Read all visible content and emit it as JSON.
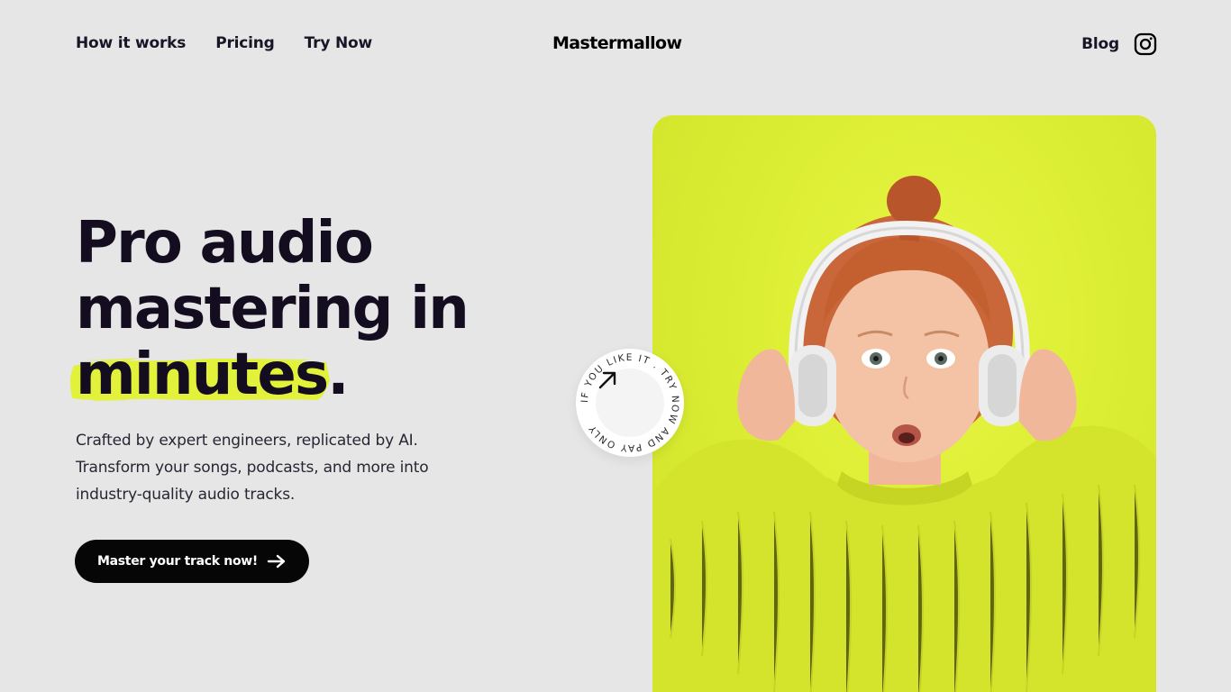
{
  "nav": {
    "links": [
      {
        "label": "How it works"
      },
      {
        "label": "Pricing"
      },
      {
        "label": "Try Now"
      }
    ],
    "brand": "Mastermallow",
    "blog": "Blog",
    "social_icon": "instagram-icon"
  },
  "hero": {
    "headline_line1": "Pro audio",
    "headline_line2": "mastering in",
    "headline_highlight": "minutes",
    "headline_period": ".",
    "subtext": [
      "Crafted by expert engineers, replicated by AI.",
      "Transform your songs, podcasts, and more into",
      "industry-quality audio tracks."
    ],
    "cta_label": "Master your track now!",
    "cta_icon": "arrow-right-icon"
  },
  "badge": {
    "circle_text": "IF YOU LIKE IT . TRY NOW AND PAY ONLY",
    "icon": "arrow-up-right-icon"
  },
  "colors": {
    "background": "#e6e6e6",
    "text_dark": "#140d1f",
    "highlight": "#e2f23a",
    "image_bg": "#dcee33",
    "sweater": "#d9e62e",
    "button_bg": "#060606"
  }
}
